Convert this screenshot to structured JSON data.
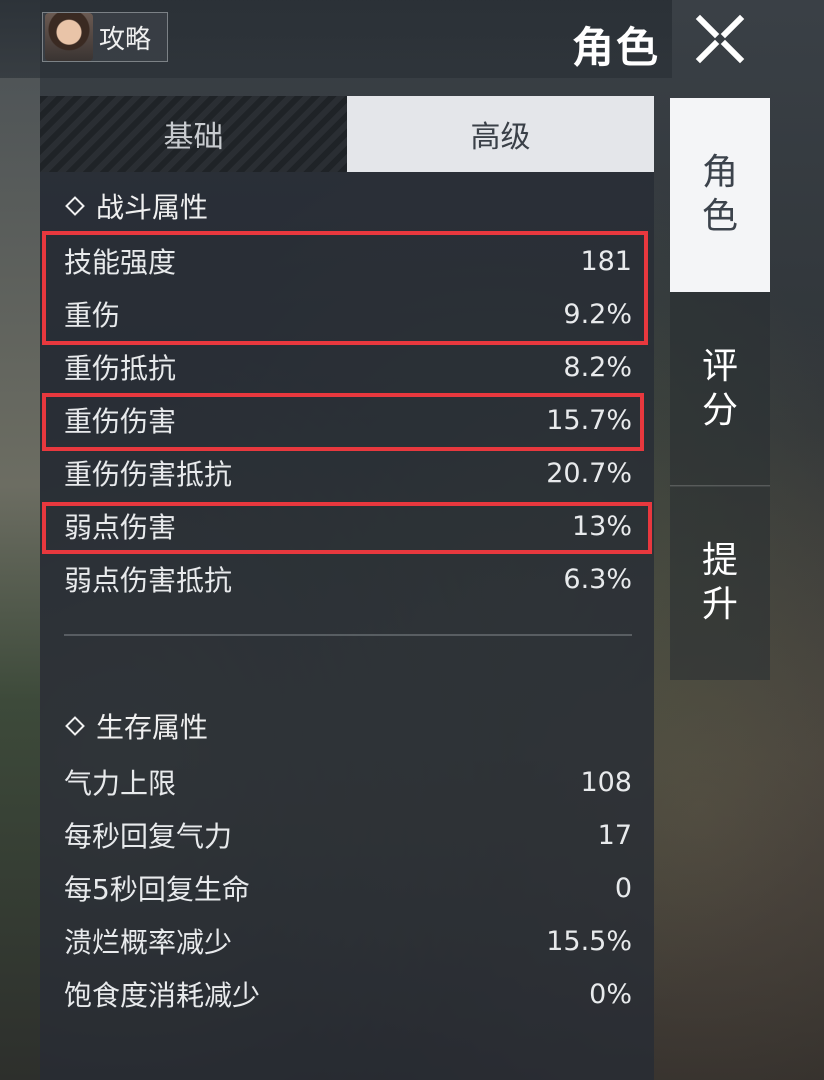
{
  "header": {
    "guide_label": "攻略",
    "page_title": "角色"
  },
  "tabs": [
    {
      "label": "基础",
      "active": false
    },
    {
      "label": "高级",
      "active": true
    }
  ],
  "side_nav": [
    {
      "label": "角\n色",
      "active": true
    },
    {
      "label": "评\n分",
      "active": false
    },
    {
      "label": "提\n升",
      "active": false
    }
  ],
  "combat": {
    "title": "战斗属性",
    "rows": [
      {
        "name": "技能强度",
        "value": "181"
      },
      {
        "name": "重伤",
        "value": "9.2%"
      },
      {
        "name": "重伤抵抗",
        "value": "8.2%"
      },
      {
        "name": "重伤伤害",
        "value": "15.7%"
      },
      {
        "name": "重伤伤害抵抗",
        "value": "20.7%"
      },
      {
        "name": "弱点伤害",
        "value": "13%"
      },
      {
        "name": "弱点伤害抵抗",
        "value": "6.3%"
      }
    ]
  },
  "survival": {
    "title": "生存属性",
    "rows": [
      {
        "name": "气力上限",
        "value": "108"
      },
      {
        "name": "每秒回复气力",
        "value": "17"
      },
      {
        "name": "每5秒回复生命",
        "value": "0"
      },
      {
        "name": "溃烂概率减少",
        "value": "15.5%"
      },
      {
        "name": "饱食度消耗减少",
        "value": "0%"
      }
    ]
  },
  "colors": {
    "highlight": "#e8383e",
    "active_tab_bg": "#e4e6ea",
    "panel_bg": "#262c34"
  },
  "icons": {
    "close": "close-icon",
    "section": "diamond-icon"
  }
}
